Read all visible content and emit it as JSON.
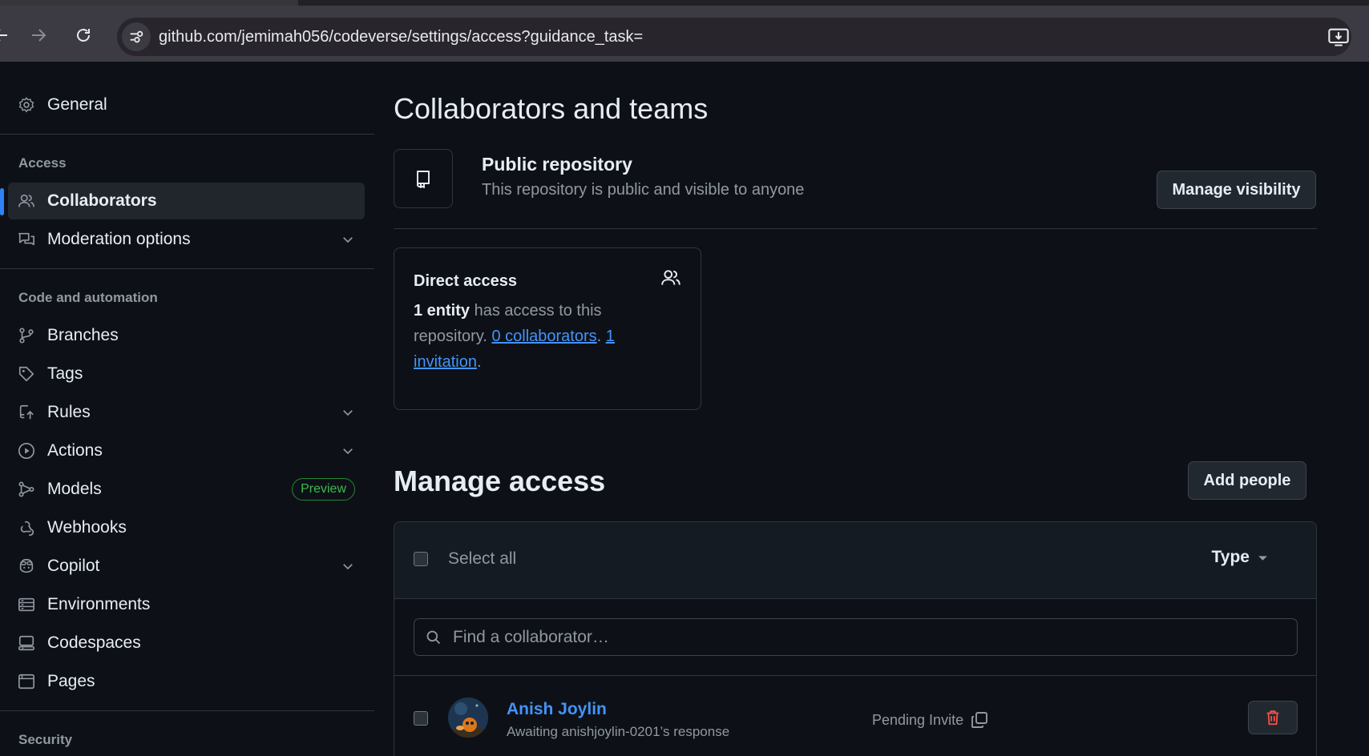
{
  "browser": {
    "url": "github.com/jemimah056/codeverse/settings/access?guidance_task="
  },
  "sidebar": {
    "general_label": "General",
    "access_heading": "Access",
    "access_items": [
      {
        "label": "Collaborators",
        "icon": "people-icon",
        "active": true
      },
      {
        "label": "Moderation options",
        "icon": "comment-discussion-icon",
        "expandable": true
      }
    ],
    "code_heading": "Code and automation",
    "code_items": [
      {
        "label": "Branches",
        "icon": "git-branch-icon"
      },
      {
        "label": "Tags",
        "icon": "tag-icon"
      },
      {
        "label": "Rules",
        "icon": "repo-push-icon",
        "expandable": true
      },
      {
        "label": "Actions",
        "icon": "play-icon",
        "expandable": true
      },
      {
        "label": "Models",
        "icon": "ai-model-icon",
        "badge": "Preview"
      },
      {
        "label": "Webhooks",
        "icon": "webhook-icon"
      },
      {
        "label": "Copilot",
        "icon": "copilot-icon",
        "expandable": true
      },
      {
        "label": "Environments",
        "icon": "server-icon"
      },
      {
        "label": "Codespaces",
        "icon": "codespaces-icon"
      },
      {
        "label": "Pages",
        "icon": "browser-icon"
      }
    ],
    "security_heading": "Security"
  },
  "main": {
    "title": "Collaborators and teams",
    "visibility": {
      "title": "Public repository",
      "subtitle": "This repository is public and visible to anyone",
      "button": "Manage visibility"
    },
    "direct_access": {
      "title": "Direct access",
      "entity_count": "1 entity",
      "text_1": " has access to this repository. ",
      "collaborators_link": "0 collaborators",
      "text_2": ". ",
      "invitation_link": "1 invitation",
      "text_3": "."
    },
    "manage_access": {
      "title": "Manage access",
      "add_button": "Add people",
      "select_all": "Select all",
      "type_filter": "Type",
      "search_placeholder": "Find a collaborator…",
      "members": [
        {
          "name": "Anish Joylin",
          "subtitle": "Awaiting anishjoylin-0201’s response",
          "status": "Pending Invite"
        }
      ]
    }
  },
  "colors": {
    "background": "#0d1117",
    "accent": "#2f81f7",
    "link": "#4493f8",
    "danger": "#f85149",
    "success": "#3fb950"
  }
}
